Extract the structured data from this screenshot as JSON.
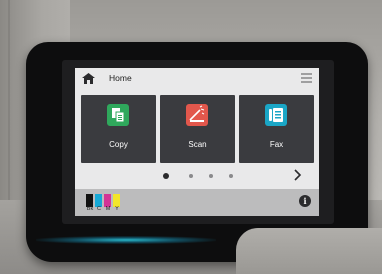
{
  "screen": {
    "header": {
      "title": "Home",
      "home_icon": "home-icon",
      "menu_icon": "hamburger-menu-icon"
    },
    "tiles": [
      {
        "label": "Copy",
        "icon": "copy-icon",
        "color": "#2fa85c"
      },
      {
        "label": "Scan",
        "icon": "scan-icon",
        "color": "#e2574c"
      },
      {
        "label": "Fax",
        "icon": "fax-icon",
        "color": "#1aa6c6"
      }
    ],
    "pager": {
      "pages": 4,
      "current_page": 1,
      "next_icon": "chevron-right-icon"
    },
    "status": {
      "ink": [
        {
          "label": "Bk",
          "color": "#111111"
        },
        {
          "label": "C",
          "color": "#16a9d6"
        },
        {
          "label": "M",
          "color": "#d33596"
        },
        {
          "label": "Y",
          "color": "#f3e62a"
        }
      ],
      "info_icon": "info-icon",
      "info_glyph": "i"
    }
  }
}
